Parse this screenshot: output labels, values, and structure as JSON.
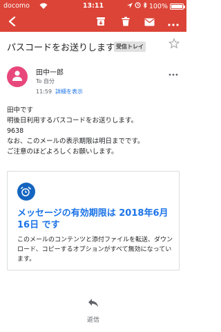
{
  "status_bar": {
    "carrier": "docomo",
    "time": "13:11",
    "battery": "100%"
  },
  "toolbar": {
    "icons": [
      "back-arrow-icon",
      "archive-icon",
      "trash-icon",
      "mail-icon",
      "more-icon"
    ],
    "color": "#db4437"
  },
  "email": {
    "subject": "パスコードをお送りします",
    "label": "受信トレイ",
    "sender": {
      "name": "田中一郎",
      "to": "To 自分",
      "time": "11:59",
      "details_link": "詳細を表示",
      "avatar_color": "#e8477c"
    },
    "body_lines": [
      "田中です",
      "明後日利用するパスコードをお送りします。",
      "9638",
      "なお、このメールの表示期限は明日までです。",
      "ご注意のほどよろしくお願いします。"
    ]
  },
  "expiry_card": {
    "title": "メッセージの有効期限は 2018年6月16日 です",
    "text": "このメールのコンテンツと添付ファイルを転送、ダウンロード、コピーするオプションがすべて無効になっています。",
    "accent": "#1a73e8"
  },
  "footer": {
    "reply_label": "返信"
  }
}
